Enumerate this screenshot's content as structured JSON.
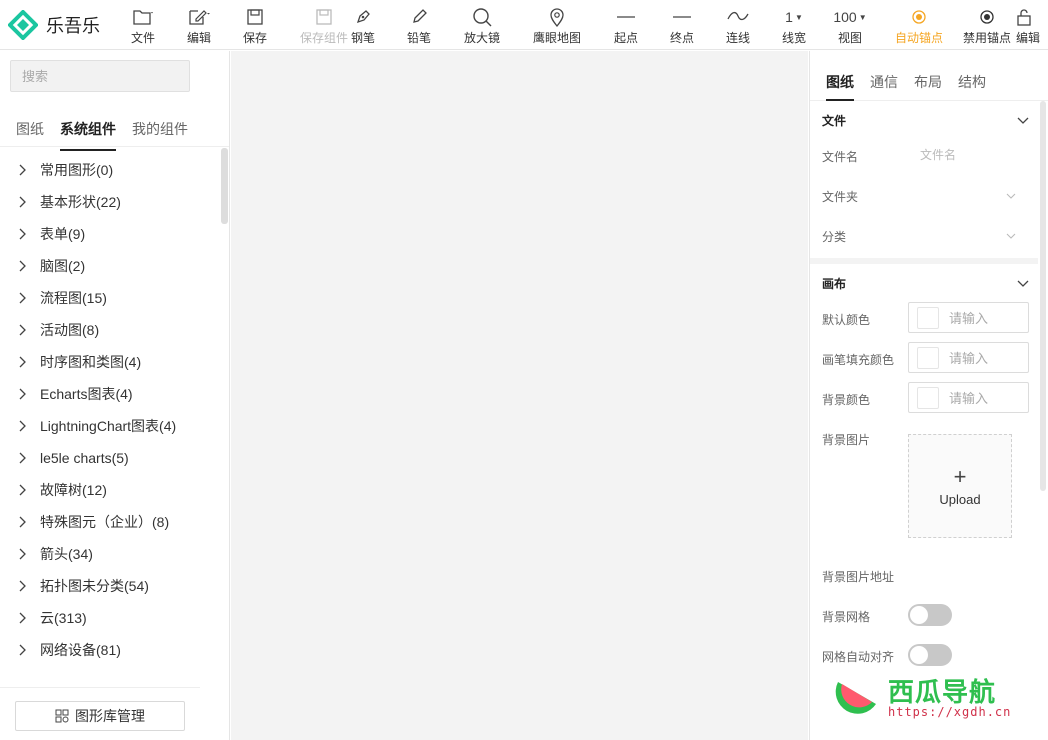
{
  "app": {
    "name": "乐吾乐",
    "brand_color": "#1bc6a0"
  },
  "toolbar": {
    "items": [
      {
        "id": "file",
        "label": "文件",
        "icon": "folder-icon",
        "dropdown": true
      },
      {
        "id": "edit",
        "label": "编辑",
        "icon": "edit-icon",
        "dropdown": true
      },
      {
        "id": "save",
        "label": "保存",
        "icon": "save-icon"
      },
      {
        "id": "save_component",
        "label": "保存组件",
        "icon": "save-icon",
        "disabled": true
      },
      {
        "id": "pen",
        "label": "钢笔",
        "icon": "pen-icon"
      },
      {
        "id": "pencil",
        "label": "铅笔",
        "icon": "pencil-icon"
      },
      {
        "id": "magnifier",
        "label": "放大镜",
        "icon": "magnifier-icon"
      },
      {
        "id": "minimap",
        "label": "鹰眼地图",
        "icon": "location-icon"
      },
      {
        "id": "start",
        "label": "起点",
        "icon": "line-start-icon"
      },
      {
        "id": "end",
        "label": "终点",
        "icon": "line-end-icon"
      },
      {
        "id": "connect",
        "label": "连线",
        "icon": "curve-icon"
      },
      {
        "id": "linewidth",
        "label": "线宽",
        "value": "1"
      },
      {
        "id": "view",
        "label": "视图",
        "value": "100"
      },
      {
        "id": "auto_anchor",
        "label": "自动锚点",
        "icon": "anchor-icon",
        "active": true
      },
      {
        "id": "disable_anchor",
        "label": "禁用锚点",
        "icon": "anchor-disabled-icon"
      },
      {
        "id": "edit_lock",
        "label": "编辑",
        "icon": "lock-icon"
      }
    ],
    "active_color": "#f5a623"
  },
  "left_panel": {
    "search_placeholder": "搜索",
    "tabs": [
      "图纸",
      "系统组件",
      "我的组件"
    ],
    "active_tab": 1,
    "tree": [
      "常用图形(0)",
      "基本形状(22)",
      "表单(9)",
      "脑图(2)",
      "流程图(15)",
      "活动图(8)",
      "时序图和类图(4)",
      "Echarts图表(4)",
      "LightningChart图表(4)",
      "le5le charts(5)",
      "故障树(12)",
      "特殊图元（企业）(8)",
      "箭头(34)",
      "拓扑图未分类(54)",
      "云(313)",
      "网络设备(81)"
    ],
    "library_button": "图形库管理"
  },
  "right_panel": {
    "tabs": [
      "图纸",
      "通信",
      "布局",
      "结构"
    ],
    "active_tab": 0,
    "file_section": {
      "title": "文件",
      "filename_label": "文件名",
      "filename_placeholder": "文件名",
      "folder_label": "文件夹",
      "category_label": "分类"
    },
    "canvas_section": {
      "title": "画布",
      "default_color_label": "默认颜色",
      "pen_fill_label": "画笔填充颜色",
      "bg_color_label": "背景颜色",
      "color_placeholder": "请输入",
      "bg_image_label": "背景图片",
      "upload_label": "Upload",
      "bg_image_url_label": "背景图片地址",
      "bg_grid_label": "背景网格",
      "bg_grid_on": false,
      "grid_snap_label": "网格自动对齐",
      "grid_snap_on": false
    }
  },
  "watermark": {
    "title": "西瓜导航",
    "url": "https://xgdh.cn"
  }
}
